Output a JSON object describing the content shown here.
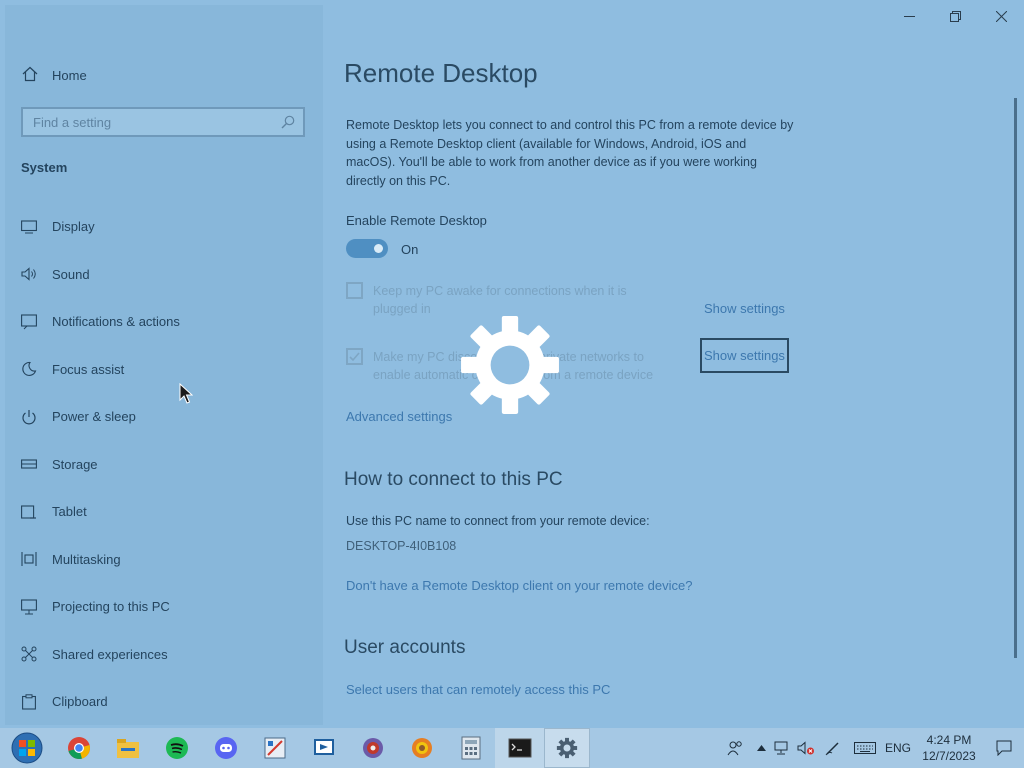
{
  "window": {
    "controls": {
      "minimize": "minimize-icon",
      "restore": "restore-icon",
      "close": "close-icon"
    }
  },
  "sidebar": {
    "home_label": "Home",
    "search_placeholder": "Find a setting",
    "group_label": "System",
    "items": [
      {
        "label": "Display",
        "icon": "display-icon"
      },
      {
        "label": "Sound",
        "icon": "sound-icon"
      },
      {
        "label": "Notifications & actions",
        "icon": "notifications-icon"
      },
      {
        "label": "Focus assist",
        "icon": "moon-icon"
      },
      {
        "label": "Power & sleep",
        "icon": "power-icon"
      },
      {
        "label": "Storage",
        "icon": "storage-icon"
      },
      {
        "label": "Tablet",
        "icon": "tablet-icon"
      },
      {
        "label": "Multitasking",
        "icon": "multitasking-icon"
      },
      {
        "label": "Projecting to this PC",
        "icon": "projecting-icon"
      },
      {
        "label": "Shared experiences",
        "icon": "shared-icon"
      },
      {
        "label": "Clipboard",
        "icon": "clipboard-icon"
      }
    ]
  },
  "main": {
    "title": "Remote Desktop",
    "description": "Remote Desktop lets you connect to and control this PC from a remote device by using a Remote Desktop client (available for Windows, Android, iOS and macOS). You'll be able to work from another device as if you were working directly on this PC.",
    "enable_label": "Enable Remote Desktop",
    "toggle_state": "On",
    "keep_awake": {
      "line1": "Keep my PC awake for connections when it is",
      "line2": "plugged in",
      "link": "Show settings",
      "checked": false
    },
    "discoverable": {
      "line1": "Make my PC discoverable on private networks to",
      "line2": "enable automatic connection from a remote device",
      "link": "Show settings",
      "checked": true
    },
    "advanced_link": "Advanced settings",
    "how_heading": "How to connect to this PC",
    "how_text": "Use this PC name to connect from your remote device:",
    "pc_name": "DESKTOP-4I0B108",
    "client_link": "Don't have a Remote Desktop client on your remote device?",
    "accounts_heading": "User accounts",
    "accounts_link": "Select users that can remotely access this PC"
  },
  "taskbar": {
    "apps": [
      "start-icon",
      "chrome-icon",
      "file-explorer-icon",
      "spotify-icon",
      "discord-icon",
      "paint-icon",
      "remote-app-icon",
      "media-disc-icon",
      "photo-app-icon",
      "calculator-icon",
      "terminal-icon",
      "settings-icon"
    ],
    "tray": {
      "language": "ENG",
      "time": "4:24 PM",
      "date": "12/7/2023"
    }
  },
  "colors": {
    "accent": "#4f8fc2",
    "link": "#3d78ae",
    "background": "#8fbde0"
  }
}
